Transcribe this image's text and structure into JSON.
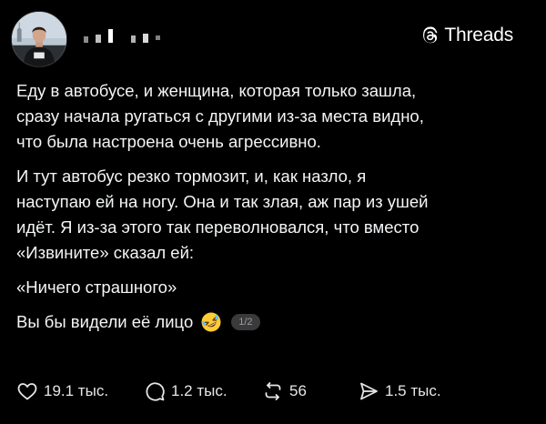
{
  "header": {
    "brand_label": "Threads"
  },
  "post": {
    "paragraphs": [
      "Еду в автобусе, и женщина, которая только зашла,\nсразу начала ругаться с другими из-за места  видно,\nчто была настроена очень агрессивно.",
      "И тут автобус резко тормозит, и, как назло, я\nнаступаю ей на ногу. Она и так злая, аж пар из ушей\nидёт. Я из-за этого так переволновался, что вместо\n«Извините» сказал ей:",
      "«Ничего страшного»"
    ],
    "last_line": "Вы бы видели её лицо",
    "emoji": "rolling-on-floor-laughing",
    "page_indicator": "1/2"
  },
  "actions": {
    "likes": "19.1 тыс.",
    "replies": "1.2 тыс.",
    "reposts": "56",
    "shares": "1.5 тыс."
  },
  "colors": {
    "background": "#000000",
    "text": "#f3f5f7",
    "badge_bg": "#3a3a3c"
  }
}
